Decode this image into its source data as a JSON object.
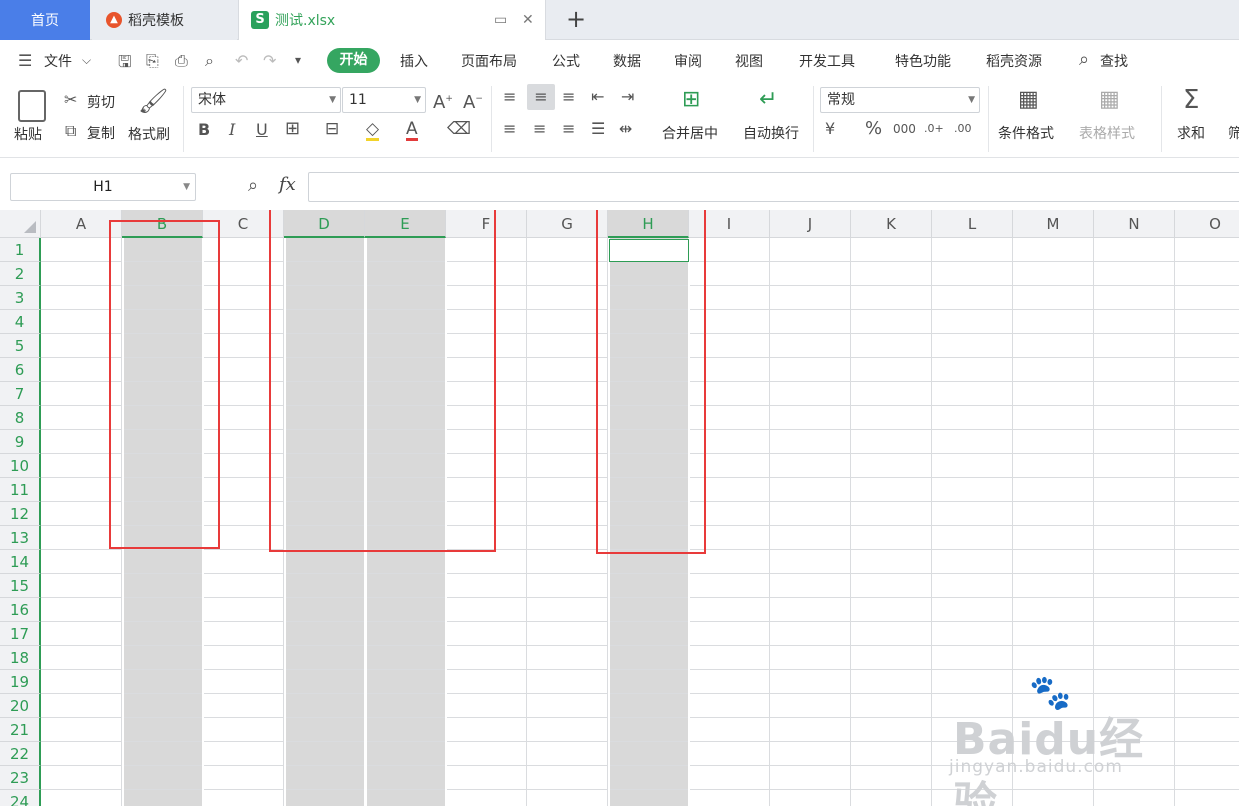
{
  "tabs": {
    "home": "首页",
    "template": "稻壳模板",
    "file": "测试.xlsx",
    "add": "+"
  },
  "menu": {
    "file": "文件",
    "items": [
      "开始",
      "插入",
      "页面布局",
      "公式",
      "数据",
      "审阅",
      "视图",
      "开发工具",
      "特色功能",
      "稻壳资源"
    ],
    "search": "查找"
  },
  "ribbon": {
    "paste": "粘贴",
    "cut": "剪切",
    "copy": "复制",
    "format_painter": "格式刷",
    "font_name": "宋体",
    "font_size": "11",
    "merge_center": "合并居中",
    "wrap_text": "自动换行",
    "number_format": "常规",
    "conditional_format": "条件格式",
    "table_style": "表格样式",
    "sum": "求和",
    "filter_partial": "筛"
  },
  "formula_bar": {
    "cell_ref": "H1",
    "fx": "fx",
    "value": ""
  },
  "sheet": {
    "columns": [
      "A",
      "B",
      "C",
      "D",
      "E",
      "F",
      "G",
      "H",
      "I",
      "J",
      "K",
      "L",
      "M",
      "N",
      "O"
    ],
    "selected_columns": [
      "B",
      "D",
      "E",
      "H"
    ],
    "active_cell": "H1",
    "rows": [
      "1",
      "2",
      "3",
      "4",
      "5",
      "6",
      "7",
      "8",
      "9",
      "10",
      "11",
      "12",
      "13",
      "14",
      "15",
      "16",
      "17",
      "18",
      "19",
      "20",
      "21",
      "22",
      "23",
      "24"
    ]
  },
  "watermark": {
    "brand": "Baidu经验",
    "url": "jingyan.baidu.com"
  },
  "colors": {
    "accent_green": "#2e9c55",
    "home_tab_blue": "#4a7ee8",
    "highlight_red": "#e83a3a",
    "selection_gray": "#d9d9d9"
  }
}
